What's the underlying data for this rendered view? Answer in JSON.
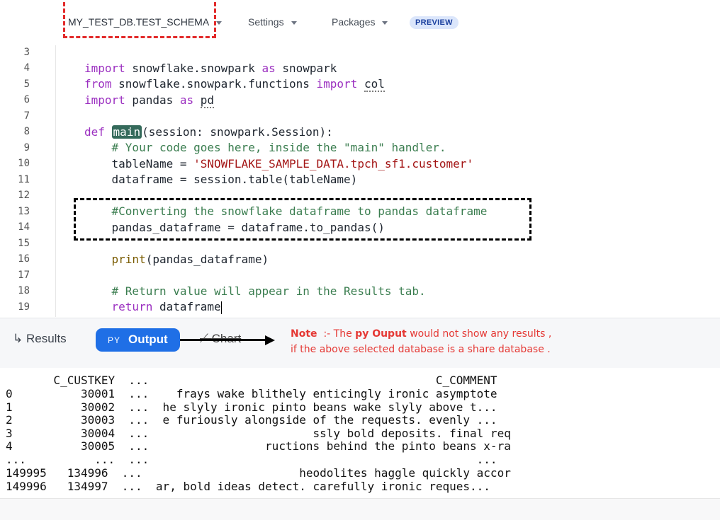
{
  "toolbar": {
    "database_schema": "MY_TEST_DB.TEST_SCHEMA",
    "settings_label": "Settings",
    "packages_label": "Packages",
    "preview_badge": "PREVIEW"
  },
  "editor": {
    "lines": [
      {
        "num": "3",
        "code": ""
      },
      {
        "num": "4",
        "code": "import snowflake.snowpark as snowpark"
      },
      {
        "num": "5",
        "code": "from snowflake.snowpark.functions import col"
      },
      {
        "num": "6",
        "code": "import pandas as pd"
      },
      {
        "num": "7",
        "code": ""
      },
      {
        "num": "8",
        "code": "def main(session: snowpark.Session):"
      },
      {
        "num": "9",
        "code": "    # Your code goes here, inside the \"main\" handler."
      },
      {
        "num": "10",
        "code": "    tableName = 'SNOWFLAKE_SAMPLE_DATA.tpch_sf1.customer'"
      },
      {
        "num": "11",
        "code": "    dataframe = session.table(tableName)"
      },
      {
        "num": "12",
        "code": ""
      },
      {
        "num": "13",
        "code": "    #Converting the snowflake dataframe to pandas dataframe"
      },
      {
        "num": "14",
        "code": "    pandas_dataframe = dataframe.to_pandas()"
      },
      {
        "num": "15",
        "code": ""
      },
      {
        "num": "16",
        "code": "    print(pandas_dataframe)"
      },
      {
        "num": "17",
        "code": ""
      },
      {
        "num": "18",
        "code": "    # Return value will appear in the Results tab."
      },
      {
        "num": "19",
        "code": "    return dataframe"
      }
    ]
  },
  "tabs": {
    "results_label": "Results",
    "output_prefix": "PY",
    "output_label": "Output",
    "chart_label": "Chart"
  },
  "note": {
    "title": "Note",
    "sep": ":-",
    "text_a": "The",
    "highlight": "py Ouput",
    "text_b": "would not show any results ,",
    "line2": "if the above selected database is a share database  ."
  },
  "output": {
    "lines": [
      "       C_CUSTKEY  ...                                          C_COMMENT",
      "0          30001  ...    frays wake blithely enticingly ironic asymptote",
      "1          30002  ...  he slyly ironic pinto beans wake slyly above t...",
      "2          30003  ...  e furiously alongside of the requests. evenly ...",
      "3          30004  ...                        ssly bold deposits. final req",
      "4          30005  ...                 ructions behind the pinto beans x-ra",
      "...          ...  ...                                                ...",
      "149995   134996  ...                       heodolites haggle quickly accor",
      "149996   134997  ...  ar, bold ideas detect. carefully ironic reques..."
    ]
  },
  "colors": {
    "accent": "#1f6fe6",
    "keyword": "#9b2fc0",
    "comment": "#3a7d4f",
    "string": "#a31515",
    "note": "#e53935"
  }
}
